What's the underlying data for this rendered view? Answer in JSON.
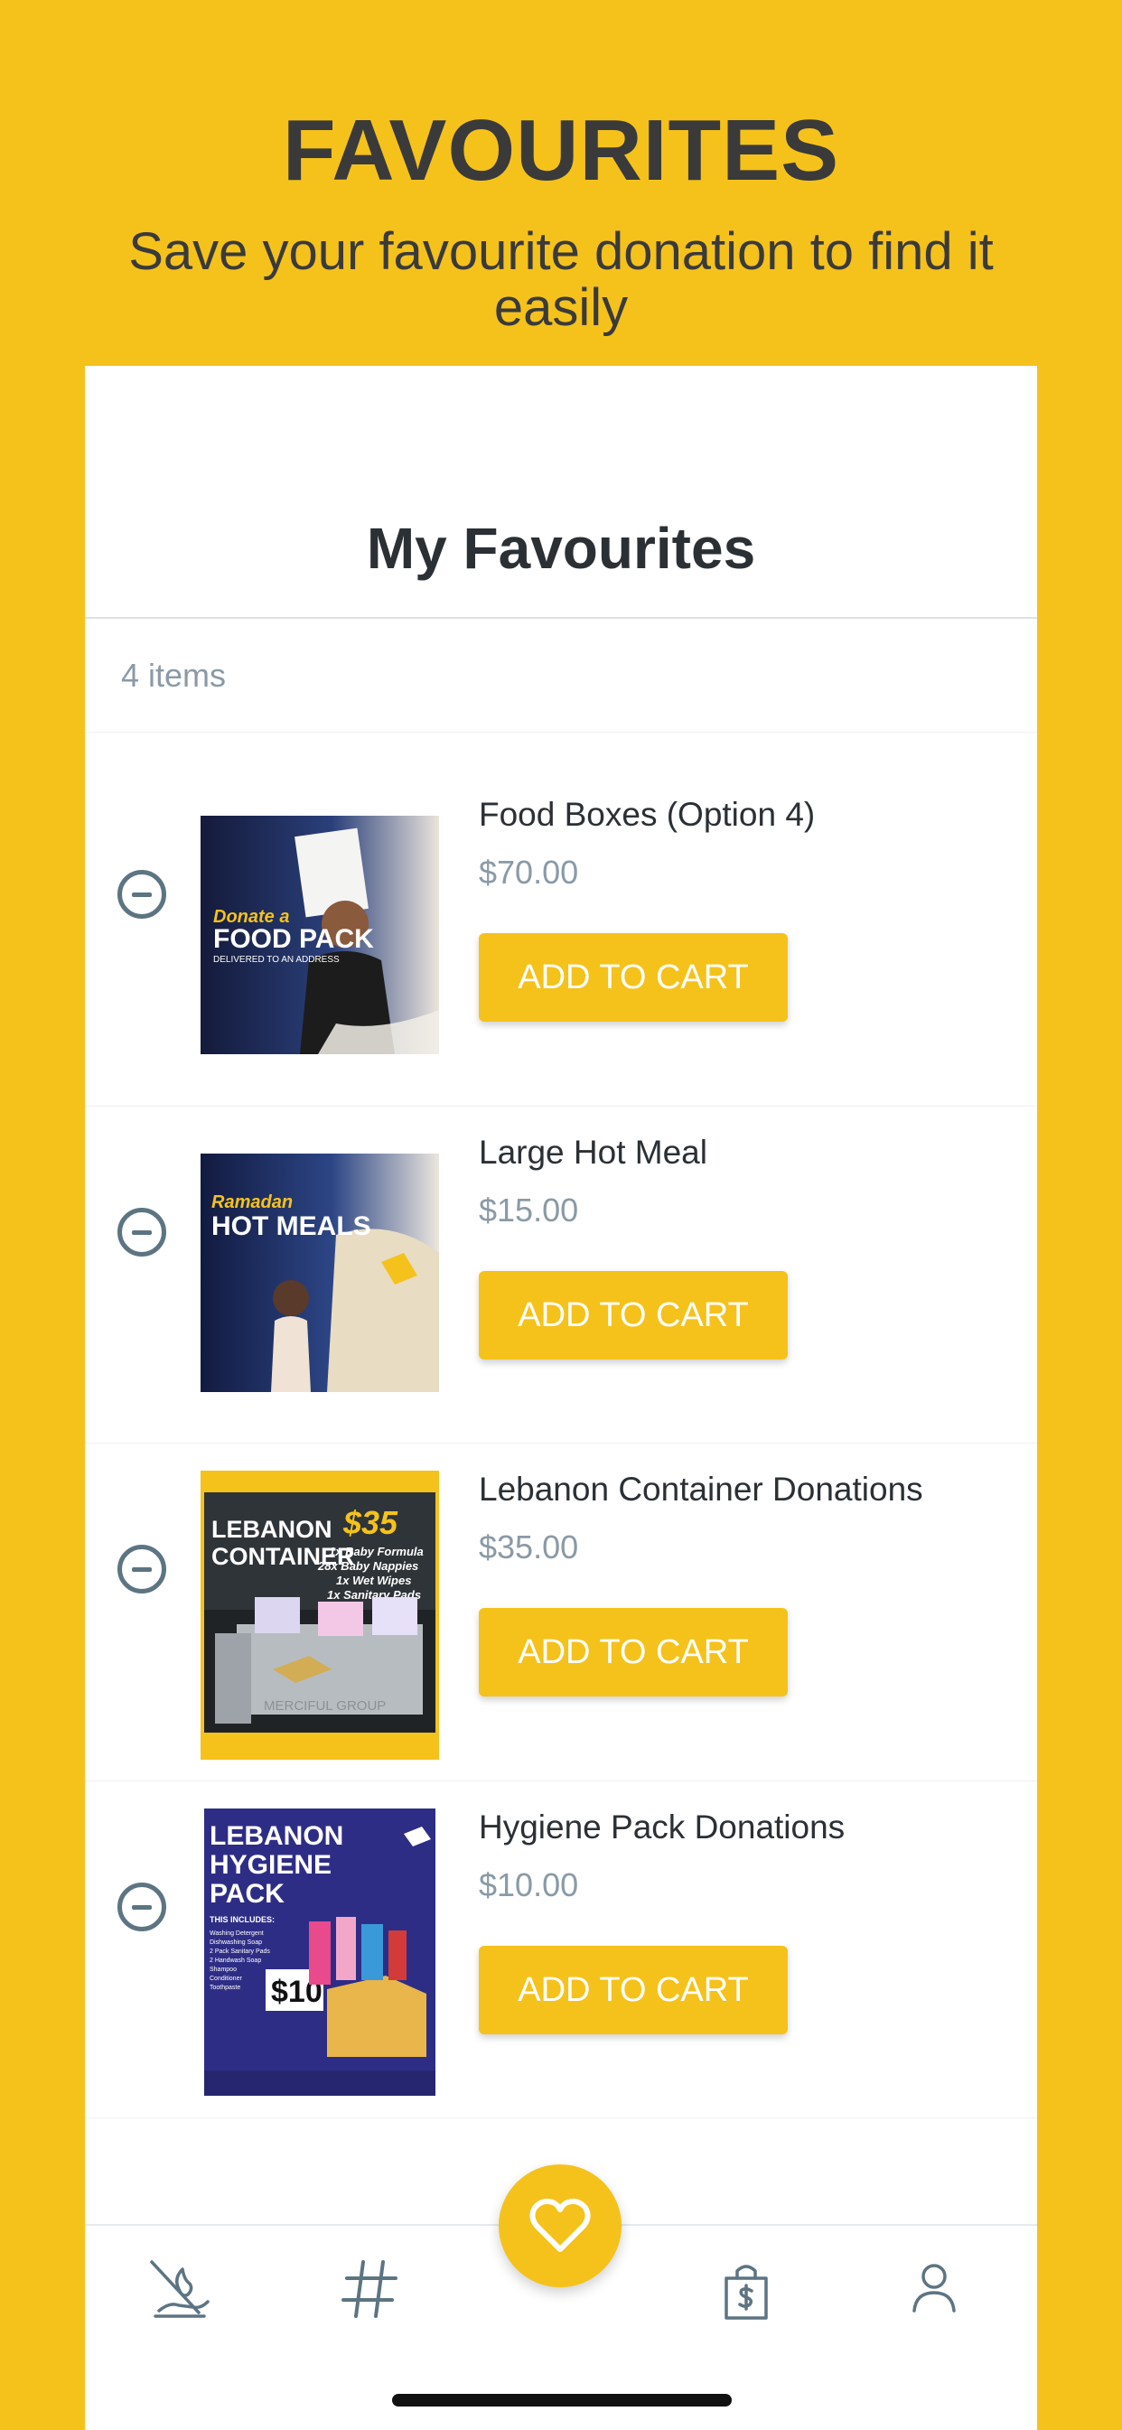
{
  "header": {
    "title": "FAVOURITES",
    "subtitle": "Save your favourite donation to find it easily"
  },
  "panel": {
    "title": "My Favourites",
    "items_count": "4 items"
  },
  "favourites": [
    {
      "name": "Food Boxes (Option 4)",
      "price": "$70.00",
      "button": "ADD TO CART",
      "image": {
        "line1": "Donate a",
        "line2": "FOOD PACK",
        "line3": "DELIVERED TO AN ADDRESS"
      }
    },
    {
      "name": "Large Hot Meal",
      "price": "$15.00",
      "button": "ADD TO CART",
      "image": {
        "line1": "Ramadan",
        "line2": "HOT MEALS"
      }
    },
    {
      "name": "Lebanon Container Donations",
      "price": "$35.00",
      "button": "ADD TO CART",
      "image": {
        "line1": "LEBANON",
        "line2": "CONTAINER",
        "price": "$35",
        "details": [
          "1x Baby Formula",
          "28x Baby Nappies",
          "1x Wet Wipes",
          "1x Sanitary Pads"
        ],
        "brand": "MERCIFUL GROUP"
      }
    },
    {
      "name": "Hygiene Pack Donations",
      "price": "$10.00",
      "button": "ADD TO CART",
      "image": {
        "line1": "LEBANON",
        "line2": "HYGIENE",
        "line3": "PACK",
        "price": "$10",
        "includes_title": "THIS INCLUDES:",
        "includes": [
          "Washing Detergent",
          "Dishwashing Soap",
          "2 Pack Sanitary Pads",
          "2 Handwash Soap",
          "Shampoo",
          "Conditioner",
          "Toothpaste"
        ]
      }
    }
  ],
  "bottom_nav": {
    "items": [
      {
        "icon": "donate-hand-icon"
      },
      {
        "icon": "hashtag-icon"
      },
      {
        "icon": "heart-icon"
      },
      {
        "icon": "shopping-bag-dollar-icon"
      },
      {
        "icon": "user-icon"
      }
    ]
  },
  "colors": {
    "accent": "#F5C21B",
    "text_dark": "#2b3035",
    "text_muted": "#8a9aa6",
    "icon_slate": "#5d7482"
  }
}
